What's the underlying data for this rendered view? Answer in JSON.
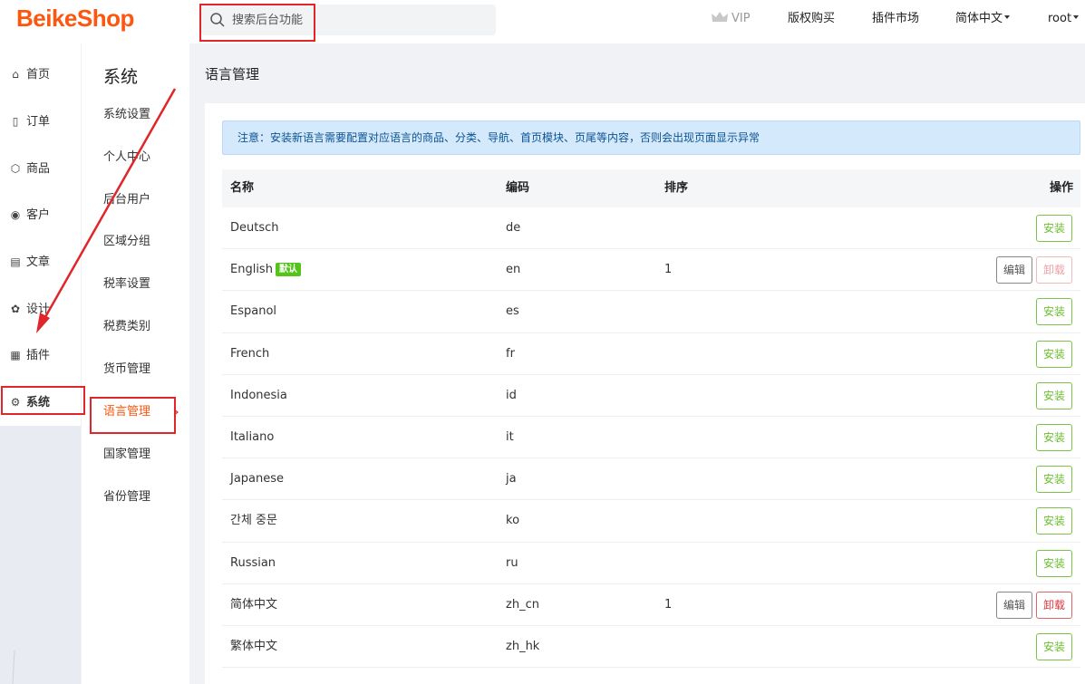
{
  "header": {
    "logo": "BeikeShop",
    "search_placeholder": "搜索后台功能",
    "vip": "VIP",
    "copyright": "版权购买",
    "marketplace": "插件市场",
    "language": "简体中文",
    "user": "root"
  },
  "sidebar": {
    "items": [
      {
        "label": "首页",
        "icon": "home-icon"
      },
      {
        "label": "订单",
        "icon": "clipboard-icon"
      },
      {
        "label": "商品",
        "icon": "box-icon"
      },
      {
        "label": "客户",
        "icon": "user-circle-icon"
      },
      {
        "label": "文章",
        "icon": "file-icon"
      },
      {
        "label": "设计",
        "icon": "palette-icon"
      },
      {
        "label": "插件",
        "icon": "plugin-icon"
      },
      {
        "label": "系统",
        "icon": "gear-icon"
      }
    ]
  },
  "submenu": {
    "title": "系统",
    "items": [
      "系统设置",
      "个人中心",
      "后台用户",
      "区域分组",
      "税率设置",
      "税费类别",
      "货币管理",
      "语言管理",
      "国家管理",
      "省份管理"
    ]
  },
  "main": {
    "title": "语言管理",
    "notice": "注意：安装新语言需要配置对应语言的商品、分类、导航、首页模块、页尾等内容，否则会出现页面显示异常",
    "columns": {
      "name": "名称",
      "code": "编码",
      "sort": "排序",
      "ops": "操作"
    },
    "labels": {
      "install": "安装",
      "edit": "编辑",
      "uninstall": "卸载",
      "default": "默认"
    },
    "rows": [
      {
        "name": "Deutsch",
        "code": "de",
        "sort": "",
        "installed": false
      },
      {
        "name": "English",
        "code": "en",
        "sort": "1",
        "installed": true,
        "default": true
      },
      {
        "name": "Espanol",
        "code": "es",
        "sort": "",
        "installed": false
      },
      {
        "name": "French",
        "code": "fr",
        "sort": "",
        "installed": false
      },
      {
        "name": "Indonesia",
        "code": "id",
        "sort": "",
        "installed": false
      },
      {
        "name": "Italiano",
        "code": "it",
        "sort": "",
        "installed": false
      },
      {
        "name": "Japanese",
        "code": "ja",
        "sort": "",
        "installed": false
      },
      {
        "name": "간체 중문",
        "code": "ko",
        "sort": "",
        "installed": false
      },
      {
        "name": "Russian",
        "code": "ru",
        "sort": "",
        "installed": false
      },
      {
        "name": "简体中文",
        "code": "zh_cn",
        "sort": "1",
        "installed": true
      },
      {
        "name": "繁体中文",
        "code": "zh_hk",
        "sort": "",
        "installed": false
      }
    ]
  },
  "colors": {
    "brand": "#fd560f",
    "install": "#6bbd30",
    "danger": "#d9363e",
    "annotation": "#e0262a"
  }
}
